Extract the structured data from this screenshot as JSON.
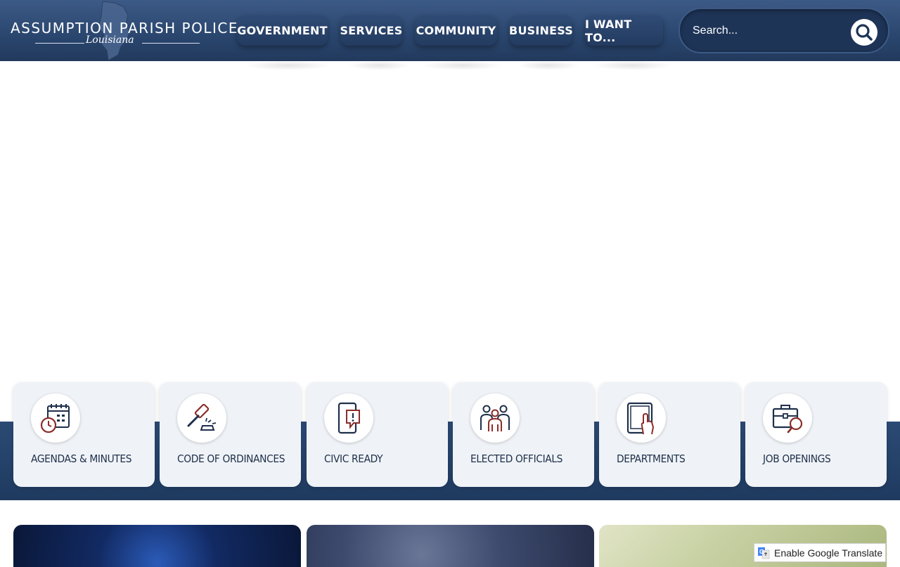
{
  "header": {
    "logo_title": "ASSUMPTION PARISH POLICE JURY",
    "logo_subtitle": "Louisiana"
  },
  "nav": {
    "items": [
      {
        "label": "GOVERNMENT"
      },
      {
        "label": "SERVICES"
      },
      {
        "label": "COMMUNITY"
      },
      {
        "label": "BUSINESS"
      },
      {
        "label": "I WANT TO..."
      }
    ]
  },
  "search": {
    "placeholder": "Search...",
    "icon": "search-icon"
  },
  "quick_links": [
    {
      "label": "AGENDAS & MINUTES",
      "icon": "calendar-clock-icon"
    },
    {
      "label": "CODE OF ORDINANCES",
      "icon": "gavel-icon"
    },
    {
      "label": "CIVIC READY",
      "icon": "phone-alert-icon"
    },
    {
      "label": "ELECTED OFFICIALS",
      "icon": "people-group-icon"
    },
    {
      "label": "DEPARTMENTS",
      "icon": "tablet-tap-icon"
    },
    {
      "label": "JOB OPENINGS",
      "icon": "briefcase-search-icon"
    }
  ],
  "colors": {
    "header": "#2a466e",
    "accent_red": "#8b2e2a",
    "icon_dark": "#1f2f4a",
    "card_bg": "#eff3f7",
    "band": "#1f3a5f"
  },
  "translate": {
    "label": "Enable Google Translate"
  }
}
